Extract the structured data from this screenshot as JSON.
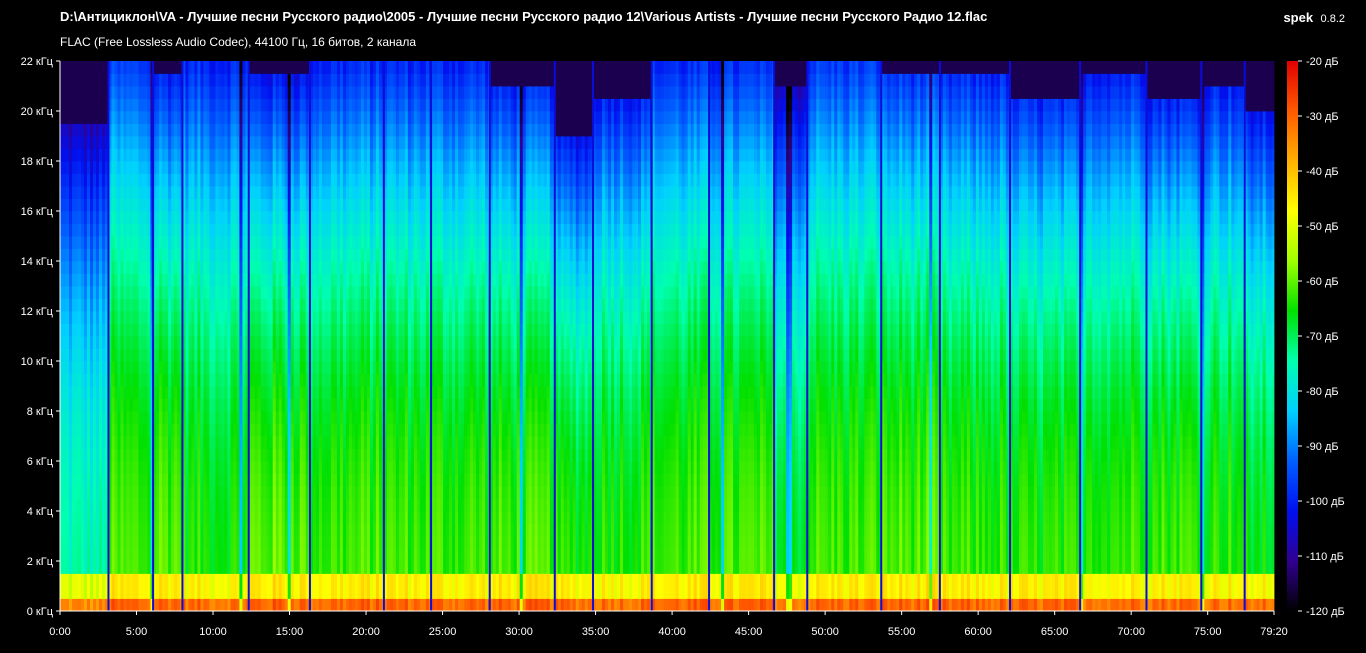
{
  "header": {
    "file_path": "D:\\Антициклон\\VA - Лучшие песни Русского радио\\2005 - Лучшие песни Русского радио 12\\Various Artists - Лучшие песни Русского Радио 12.flac",
    "file_info": "FLAC (Free Lossless Audio Codec), 44100 Гц, 16 битов, 2 канала",
    "app_name": "spek",
    "app_version": "0.8.2"
  },
  "chart_data": {
    "type": "heatmap",
    "title": "D:\\Антициклон\\VA - Лучшие песни Русского радио\\2005 - Лучшие песни Русского радио 12\\Various Artists - Лучшие песни Русского Радио 12.flac",
    "subtitle": "FLAC (Free Lossless Audio Codec), 44100 Гц, 16 битов, 2 канала",
    "x_axis": {
      "unit": "time (mm:ss)",
      "range_seconds": [
        0,
        4760
      ],
      "ticks": [
        {
          "label": "0:00",
          "value": 0
        },
        {
          "label": "5:00",
          "value": 300
        },
        {
          "label": "10:00",
          "value": 600
        },
        {
          "label": "15:00",
          "value": 900
        },
        {
          "label": "20:00",
          "value": 1200
        },
        {
          "label": "25:00",
          "value": 1500
        },
        {
          "label": "30:00",
          "value": 1800
        },
        {
          "label": "35:00",
          "value": 2100
        },
        {
          "label": "40:00",
          "value": 2400
        },
        {
          "label": "45:00",
          "value": 2700
        },
        {
          "label": "50:00",
          "value": 3000
        },
        {
          "label": "55:00",
          "value": 3300
        },
        {
          "label": "60:00",
          "value": 3600
        },
        {
          "label": "65:00",
          "value": 3900
        },
        {
          "label": "70:00",
          "value": 4200
        },
        {
          "label": "75:00",
          "value": 4500
        },
        {
          "label": "79:20",
          "value": 4760
        }
      ]
    },
    "y_axis": {
      "unit": "kHz",
      "range": [
        0,
        22
      ],
      "ticks": [
        {
          "label": "0 кГц",
          "value": 0
        },
        {
          "label": "2 кГц",
          "value": 2
        },
        {
          "label": "4 кГц",
          "value": 4
        },
        {
          "label": "6 кГц",
          "value": 6
        },
        {
          "label": "8 кГц",
          "value": 8
        },
        {
          "label": "10 кГц",
          "value": 10
        },
        {
          "label": "12 кГц",
          "value": 12
        },
        {
          "label": "14 кГц",
          "value": 14
        },
        {
          "label": "16 кГц",
          "value": 16
        },
        {
          "label": "18 кГц",
          "value": 18
        },
        {
          "label": "20 кГц",
          "value": 20
        },
        {
          "label": "22 кГц",
          "value": 22
        }
      ]
    },
    "color_scale": {
      "unit": "dB",
      "range": [
        -120,
        -20
      ],
      "ticks": [
        {
          "label": "-20 дБ",
          "value": -20
        },
        {
          "label": "-30 дБ",
          "value": -30
        },
        {
          "label": "-40 дБ",
          "value": -40
        },
        {
          "label": "-50 дБ",
          "value": -50
        },
        {
          "label": "-60 дБ",
          "value": -60
        },
        {
          "label": "-70 дБ",
          "value": -70
        },
        {
          "label": "-80 дБ",
          "value": -80
        },
        {
          "label": "-90 дБ",
          "value": -90
        },
        {
          "label": "-100 дБ",
          "value": -100
        },
        {
          "label": "-110 дБ",
          "value": -110
        },
        {
          "label": "-120 дБ",
          "value": -120
        }
      ],
      "colors": [
        "#e00000",
        "#ff5a00",
        "#ffb000",
        "#ffff00",
        "#a0ff00",
        "#00e000",
        "#00ffb0",
        "#00d0ff",
        "#0060ff",
        "#0010f0",
        "#300090",
        "#000000"
      ]
    },
    "tracks": [
      {
        "start": 0,
        "end": 190,
        "floor": -75,
        "top_db": -108,
        "cutoff": 19.5
      },
      {
        "start": 190,
        "end": 365,
        "floor": -62,
        "top_db": -98,
        "cutoff": 22
      },
      {
        "start": 365,
        "end": 480,
        "floor": -60,
        "top_db": -100,
        "cutoff": 21.5
      },
      {
        "start": 480,
        "end": 740,
        "floor": -64,
        "top_db": -100,
        "cutoff": 22
      },
      {
        "start": 740,
        "end": 980,
        "floor": -60,
        "top_db": -102,
        "cutoff": 21.5
      },
      {
        "start": 980,
        "end": 1270,
        "floor": -62,
        "top_db": -100,
        "cutoff": 22
      },
      {
        "start": 1270,
        "end": 1455,
        "floor": -62,
        "top_db": -100,
        "cutoff": 22
      },
      {
        "start": 1455,
        "end": 1685,
        "floor": -62,
        "top_db": -100,
        "cutoff": 22
      },
      {
        "start": 1685,
        "end": 1940,
        "floor": -62,
        "top_db": -100,
        "cutoff": 21
      },
      {
        "start": 1940,
        "end": 2090,
        "floor": -64,
        "top_db": -102,
        "cutoff": 19
      },
      {
        "start": 2090,
        "end": 2320,
        "floor": -63,
        "top_db": -100,
        "cutoff": 20.5
      },
      {
        "start": 2320,
        "end": 2545,
        "floor": -62,
        "top_db": -100,
        "cutoff": 22
      },
      {
        "start": 2545,
        "end": 2800,
        "floor": -62,
        "top_db": -100,
        "cutoff": 22
      },
      {
        "start": 2800,
        "end": 2930,
        "floor": -66,
        "top_db": -106,
        "cutoff": 21
      },
      {
        "start": 2930,
        "end": 3220,
        "floor": -62,
        "top_db": -98,
        "cutoff": 22
      },
      {
        "start": 3220,
        "end": 3450,
        "floor": -61,
        "top_db": -98,
        "cutoff": 21.5
      },
      {
        "start": 3450,
        "end": 3725,
        "floor": -63,
        "top_db": -100,
        "cutoff": 21.5
      },
      {
        "start": 3725,
        "end": 4000,
        "floor": -64,
        "top_db": -100,
        "cutoff": 20.5
      },
      {
        "start": 4000,
        "end": 4260,
        "floor": -62,
        "top_db": -100,
        "cutoff": 21.5
      },
      {
        "start": 4260,
        "end": 4475,
        "floor": -62,
        "top_db": -100,
        "cutoff": 20.5
      },
      {
        "start": 4475,
        "end": 4645,
        "floor": -63,
        "top_db": -100,
        "cutoff": 21
      },
      {
        "start": 4645,
        "end": 4760,
        "floor": -66,
        "top_db": -102,
        "cutoff": 20
      }
    ]
  }
}
